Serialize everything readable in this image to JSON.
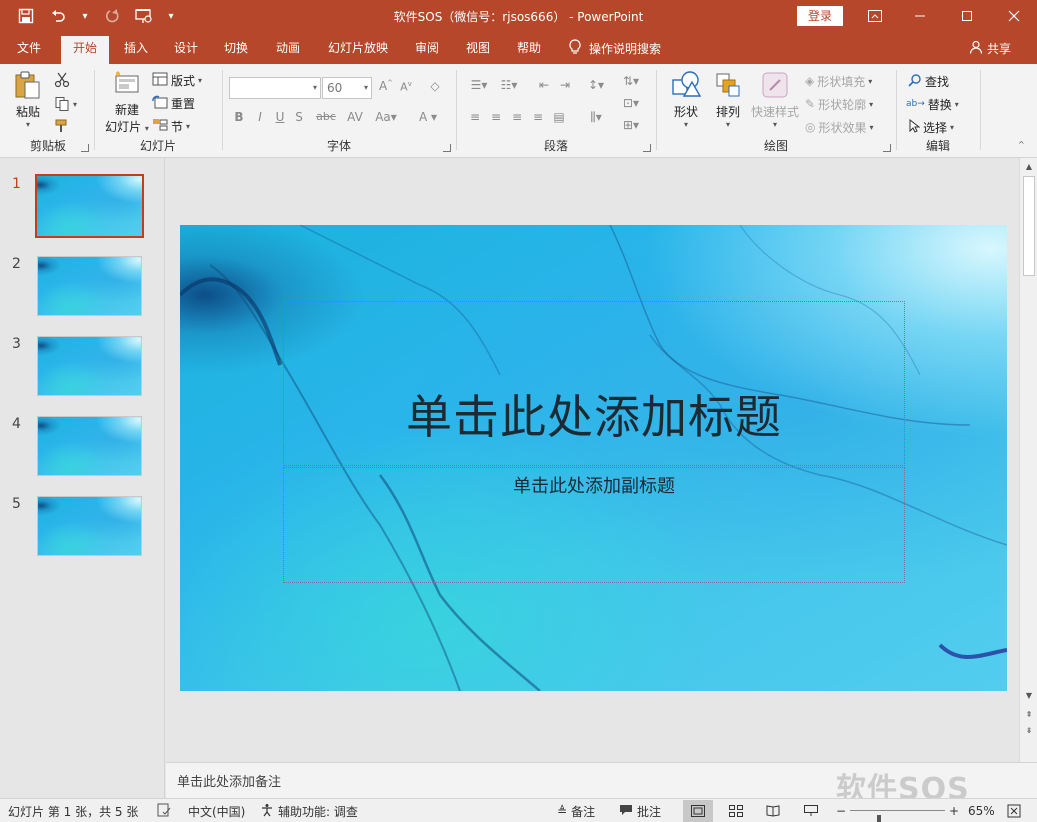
{
  "window": {
    "title": "软件SOS（微信号：rjsos666） - PowerPoint",
    "login_label": "登录",
    "colors": {
      "accent": "#b7472a",
      "selection": "#c43e1c",
      "ribbon_bg": "#f3f3f3",
      "canvas_bg": "#e6e6e6"
    }
  },
  "qat": {
    "icons": [
      "save-icon",
      "undo-icon",
      "redo-icon",
      "start-from-beginning-icon",
      "customize-qat-icon"
    ]
  },
  "tabs": [
    {
      "label": "文件"
    },
    {
      "label": "开始",
      "active": true
    },
    {
      "label": "插入"
    },
    {
      "label": "设计"
    },
    {
      "label": "切换"
    },
    {
      "label": "动画"
    },
    {
      "label": "幻灯片放映"
    },
    {
      "label": "审阅"
    },
    {
      "label": "视图"
    },
    {
      "label": "帮助"
    }
  ],
  "tellme": {
    "label": "操作说明搜索"
  },
  "share": {
    "label": "共享"
  },
  "ribbon": {
    "clipboard": {
      "label": "剪贴板",
      "paste": "粘贴"
    },
    "slides": {
      "label": "幻灯片",
      "new_slide_line1": "新建",
      "new_slide_line2": "幻灯片",
      "layout": "版式",
      "reset": "重置",
      "section": "节"
    },
    "font": {
      "label": "字体",
      "font_name": "",
      "font_size": "60"
    },
    "paragraph": {
      "label": "段落"
    },
    "drawing": {
      "label": "绘图",
      "shapes": "形状",
      "arrange": "排列",
      "quick_styles": "快速样式",
      "shape_fill": "形状填充",
      "shape_outline": "形状轮廓",
      "shape_effects": "形状效果"
    },
    "editing": {
      "label": "编辑",
      "find": "查找",
      "replace": "替换",
      "select": "选择"
    }
  },
  "thumbnails": [
    {
      "number": "1",
      "selected": true
    },
    {
      "number": "2",
      "selected": false
    },
    {
      "number": "3",
      "selected": false
    },
    {
      "number": "4",
      "selected": false
    },
    {
      "number": "5",
      "selected": false
    }
  ],
  "slide": {
    "title_placeholder": "单击此处添加标题",
    "subtitle_placeholder": "单击此处添加副标题"
  },
  "notes": {
    "placeholder": "单击此处添加备注"
  },
  "watermark": {
    "text": "软件SOS"
  },
  "statusbar": {
    "slide_info": "幻灯片 第 1 张，共 5 张",
    "language": "中文(中国)",
    "accessibility": "辅助功能: 调查",
    "notes_label": "备注",
    "comments_label": "批注",
    "zoom": "65%",
    "zoom_fraction": 0.65
  }
}
